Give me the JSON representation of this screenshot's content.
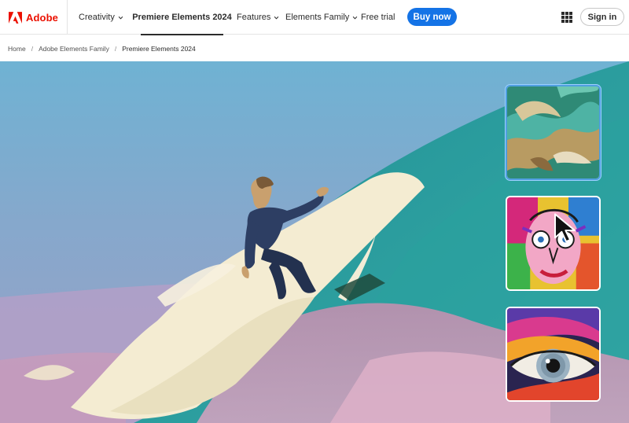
{
  "brand": {
    "name": "Adobe",
    "color": "#eb1000"
  },
  "nav": {
    "creativity": "Creativity",
    "product": "Premiere Elements 2024",
    "features": "Features",
    "elements_family": "Elements Family",
    "free_trial": "Free trial",
    "buy_now": "Buy now",
    "sign_in": "Sign in",
    "accent": "#1473e6"
  },
  "breadcrumb": {
    "home": "Home",
    "family": "Adobe Elements Family",
    "current": "Premiere Elements 2024",
    "separator": "/"
  },
  "hero": {
    "thumbnails": [
      {
        "style": "green-swirl-paint",
        "selected": true
      },
      {
        "style": "pop-art-face"
      },
      {
        "style": "colorful-eye"
      }
    ],
    "selected_thumbnail": 1
  },
  "icons": {
    "logo": "adobe-logo-icon",
    "chevron": "chevron-down-icon",
    "apps": "app-grid-icon",
    "cursor": "mouse-pointer-icon"
  }
}
